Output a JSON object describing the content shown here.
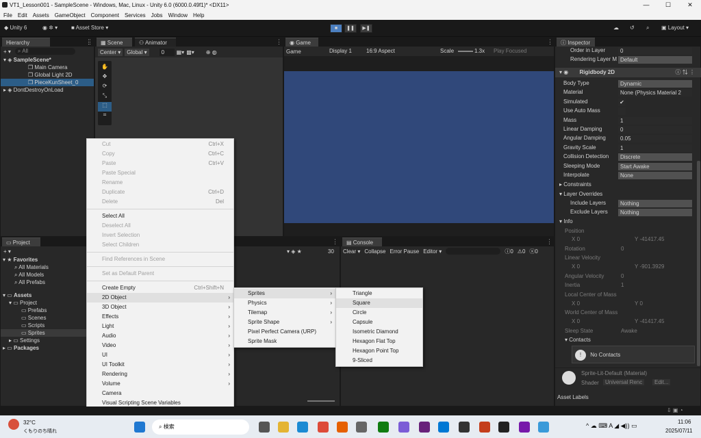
{
  "window": {
    "title": "VT1_Lesson001 - SampleScene - Windows, Mac, Linux - Unity 6.0 (6000.0.49f1)* <DX11>",
    "min": "—",
    "max": "☐",
    "close": "✕"
  },
  "menubar": [
    "File",
    "Edit",
    "Assets",
    "GameObject",
    "Component",
    "Services",
    "Jobs",
    "Window",
    "Help"
  ],
  "toolbar": {
    "unity": "Unity 6",
    "asset_store": "Asset Store ▾",
    "layout": "Layout ▾"
  },
  "hierarchy": {
    "tab": "Hierarchy",
    "search": "All",
    "items": [
      "SampleScene*",
      "Main Camera",
      "Global Light 2D",
      "PieceKunSheet_0",
      "DontDestroyOnLoad"
    ]
  },
  "scene": {
    "tab": "Scene",
    "anim_tab": "Animator",
    "center": "Center ▾",
    "global": "Global ▾",
    "grid": "0"
  },
  "game": {
    "tab": "Game",
    "mode": "Game",
    "display": "Display 1",
    "aspect": "16:9 Aspect",
    "scale_label": "Scale",
    "scale": "1.3x",
    "play_focused": "Play Focused"
  },
  "inspector": {
    "tab": "Inspector",
    "order_label": "Order in Layer",
    "order_value": "0",
    "rlayer_label": "Rendering Layer M",
    "rlayer_value": "Default",
    "component": "Rigidbody 2D",
    "fields": [
      [
        "Body Type",
        "Dynamic"
      ],
      [
        "Material",
        "None (Physics Material 2"
      ],
      [
        "Simulated",
        "✔"
      ],
      [
        "Use Auto Mass",
        ""
      ],
      [
        "Mass",
        "1"
      ],
      [
        "Linear Damping",
        "0"
      ],
      [
        "Angular Damping",
        "0.05"
      ],
      [
        "Gravity Scale",
        "1"
      ],
      [
        "Collision Detection",
        "Discrete"
      ],
      [
        "Sleeping Mode",
        "Start Awake"
      ],
      [
        "Interpolate",
        "None"
      ]
    ],
    "constraints": "Constraints",
    "layer_overrides": "Layer Overrides",
    "include": "Include Layers",
    "include_val": "Nothing",
    "exclude": "Exclude Layers",
    "exclude_val": "Nothing",
    "info": "Info",
    "position": "Position",
    "px": "0",
    "py": "-41417.45",
    "rotation": "Rotation",
    "rot": "0",
    "linvel": "Linear Velocity",
    "vx": "0",
    "vy": "-901.3929",
    "angvel": "Angular Velocity",
    "angvel_val": "0",
    "inertia": "Inertia",
    "inertia_val": "1",
    "lcom": "Local Center of Mass",
    "lx": "0",
    "ly": "0",
    "wcom": "World Center of Mass",
    "wx": "0",
    "wy": "-41417.45",
    "sleep_state": "Sleep State",
    "sleep_val": "Awake",
    "contacts": "Contacts",
    "no_contacts": "No Contacts",
    "material_name": "Sprite-Lit-Default (Material)",
    "shader": "Shader",
    "shader_val": "Universal Renc",
    "edit": "Edit...",
    "asset_labels": "Asset Labels",
    "x": "X",
    "y": "Y"
  },
  "project": {
    "tab": "Project",
    "favorites": "Favorites",
    "fav_items": [
      "All Materials",
      "All Models",
      "All Prefabs"
    ],
    "assets": "Assets",
    "asset_items": [
      "Project",
      "Prefabs",
      "Scenes",
      "Scripts",
      "Sprites",
      "Settings",
      "Packages"
    ],
    "count": "30"
  },
  "console": {
    "tab": "Console",
    "clear": "Clear ▾",
    "collapse": "Collapse",
    "error_pause": "Error Pause",
    "editor": "Editor ▾",
    "c1": "0",
    "c2": "0",
    "c3": "0"
  },
  "context_menu": [
    {
      "label": "Cut",
      "shortcut": "Ctrl+X",
      "disabled": true
    },
    {
      "label": "Copy",
      "shortcut": "Ctrl+C",
      "disabled": true
    },
    {
      "label": "Paste",
      "shortcut": "Ctrl+V",
      "disabled": true
    },
    {
      "label": "Paste Special",
      "shortcut": "",
      "disabled": true
    },
    {
      "label": "Rename",
      "shortcut": "",
      "disabled": true
    },
    {
      "label": "Duplicate",
      "shortcut": "Ctrl+D",
      "disabled": true
    },
    {
      "label": "Delete",
      "shortcut": "Del",
      "disabled": true
    },
    {
      "sep": true
    },
    {
      "label": "Select All",
      "shortcut": "",
      "disabled": false
    },
    {
      "label": "Deselect All",
      "shortcut": "",
      "disabled": true
    },
    {
      "label": "Invert Selection",
      "shortcut": "",
      "disabled": true
    },
    {
      "label": "Select Children",
      "shortcut": "",
      "disabled": true
    },
    {
      "sep": true
    },
    {
      "label": "Find References in Scene",
      "shortcut": "",
      "disabled": true
    },
    {
      "sep": true
    },
    {
      "label": "Set as Default Parent",
      "shortcut": "",
      "disabled": true
    },
    {
      "sep": true
    },
    {
      "label": "Create Empty",
      "shortcut": "Ctrl+Shift+N",
      "disabled": false
    },
    {
      "label": "2D Object",
      "shortcut": "",
      "disabled": false,
      "sub": true,
      "hl": true
    },
    {
      "label": "3D Object",
      "shortcut": "",
      "disabled": false,
      "sub": true
    },
    {
      "label": "Effects",
      "shortcut": "",
      "disabled": false,
      "sub": true
    },
    {
      "label": "Light",
      "shortcut": "",
      "disabled": false,
      "sub": true
    },
    {
      "label": "Audio",
      "shortcut": "",
      "disabled": false,
      "sub": true
    },
    {
      "label": "Video",
      "shortcut": "",
      "disabled": false,
      "sub": true
    },
    {
      "label": "UI",
      "shortcut": "",
      "disabled": false,
      "sub": true
    },
    {
      "label": "UI Toolkit",
      "shortcut": "",
      "disabled": false,
      "sub": true
    },
    {
      "label": "Rendering",
      "shortcut": "",
      "disabled": false,
      "sub": true
    },
    {
      "label": "Volume",
      "shortcut": "",
      "disabled": false,
      "sub": true
    },
    {
      "label": "Camera",
      "shortcut": "",
      "disabled": false
    },
    {
      "label": "Visual Scripting Scene Variables",
      "shortcut": "",
      "disabled": false
    }
  ],
  "submenu_2d": [
    {
      "label": "Sprites",
      "sub": true,
      "hl": true
    },
    {
      "label": "Physics",
      "sub": true
    },
    {
      "label": "Tilemap",
      "sub": true
    },
    {
      "label": "Sprite Shape",
      "sub": true
    },
    {
      "label": "Pixel Perfect Camera (URP)"
    },
    {
      "label": "Sprite Mask"
    }
  ],
  "submenu_sprites": [
    {
      "label": "Triangle"
    },
    {
      "label": "Square",
      "hl": true
    },
    {
      "label": "Circle"
    },
    {
      "label": "Capsule"
    },
    {
      "label": "Isometric Diamond"
    },
    {
      "label": "Hexagon Flat Top"
    },
    {
      "label": "Hexagon Point Top"
    },
    {
      "label": "9-Sliced"
    }
  ],
  "taskbar": {
    "temp": "32°C",
    "weather": "くもりのち晴れ",
    "search": "検索",
    "time": "11:06",
    "date": "2025/07/11",
    "ime": "A"
  },
  "colors": {
    "game_bg": "#30487a",
    "selection": "#2c5d87"
  }
}
